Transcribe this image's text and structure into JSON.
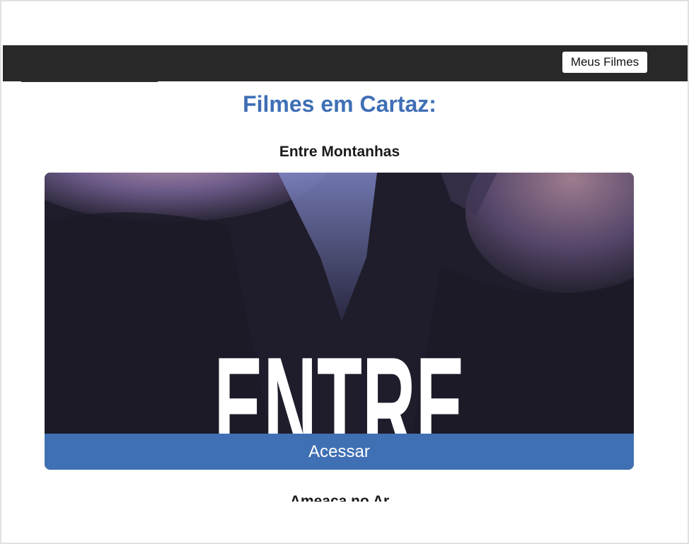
{
  "navbar": {
    "my_movies_label": "Meus Filmes"
  },
  "main": {
    "heading": "Filmes em Cartaz:",
    "movies": [
      {
        "title": "Entre Montanhas",
        "poster_text": "ENTRE",
        "action_label": "Acessar"
      },
      {
        "title": "Ameaça no Ar"
      }
    ]
  },
  "colors": {
    "navbar_bg": "#282828",
    "heading": "#3f6fb5",
    "action_button": "#4070b4"
  }
}
